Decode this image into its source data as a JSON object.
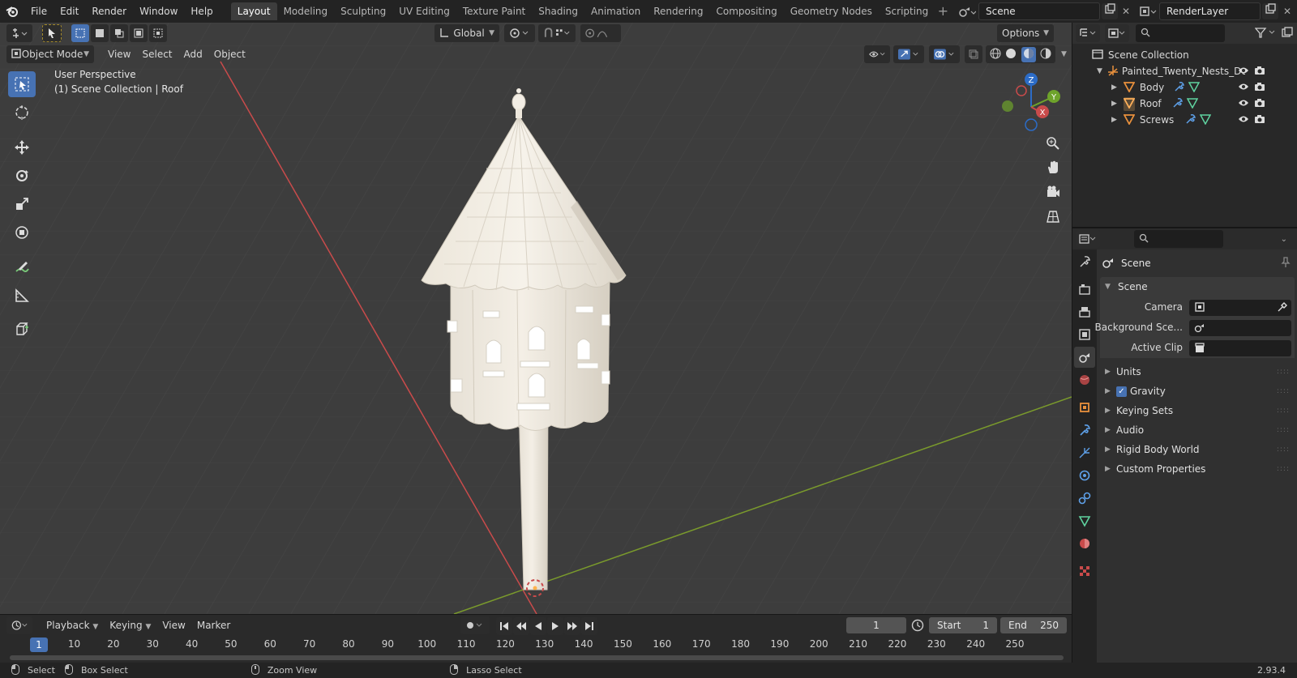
{
  "topbar": {
    "menus": [
      "File",
      "Edit",
      "Render",
      "Window",
      "Help"
    ],
    "workspaces": [
      "Layout",
      "Modeling",
      "Sculpting",
      "UV Editing",
      "Texture Paint",
      "Shading",
      "Animation",
      "Rendering",
      "Compositing",
      "Geometry Nodes",
      "Scripting"
    ],
    "active_workspace": "Layout",
    "scene_name": "Scene",
    "view_layer": "RenderLayer"
  },
  "viewport": {
    "transform_orientation": "Global",
    "options_label": "Options",
    "mode": "Object Mode",
    "menus": [
      "View",
      "Select",
      "Add",
      "Object"
    ],
    "perspective_label": "User Perspective",
    "collection_label": "(1) Scene Collection | Roof",
    "gizmo": {
      "x": "X",
      "y": "Y",
      "z": "Z"
    },
    "colors": {
      "background": "#3d3d3d",
      "grid": "#4a4a4a",
      "x_axis": "#c94b4b",
      "y_axis": "#7a9a2c",
      "active_tool": "#4772b3",
      "model": "#f1ece3"
    }
  },
  "timeline": {
    "menus": [
      "Playback",
      "Keying",
      "View",
      "Marker"
    ],
    "current_frame": "1",
    "start_label": "Start",
    "start_value": "1",
    "end_label": "End",
    "end_value": "250",
    "ruler": [
      "1",
      "10",
      "20",
      "30",
      "40",
      "50",
      "60",
      "70",
      "80",
      "90",
      "100",
      "110",
      "120",
      "130",
      "140",
      "150",
      "160",
      "170",
      "180",
      "190",
      "200",
      "210",
      "220",
      "230",
      "240",
      "250"
    ]
  },
  "statusbar": {
    "select": "Select",
    "box_select": "Box Select",
    "zoom_view": "Zoom View",
    "lasso_select": "Lasso Select",
    "version": "2.93.4"
  },
  "outliner": {
    "root": "Scene Collection",
    "collection": "Painted_Twenty_Nests_Dove",
    "objects": [
      "Body",
      "Roof",
      "Screws"
    ]
  },
  "properties": {
    "context": "Scene",
    "panel": "Scene",
    "camera_label": "Camera",
    "background_scene_label": "Background Sce...",
    "active_clip_label": "Active Clip",
    "sections": [
      "Units",
      "Gravity",
      "Keying Sets",
      "Audio",
      "Rigid Body World",
      "Custom Properties"
    ],
    "gravity_checked": true
  }
}
